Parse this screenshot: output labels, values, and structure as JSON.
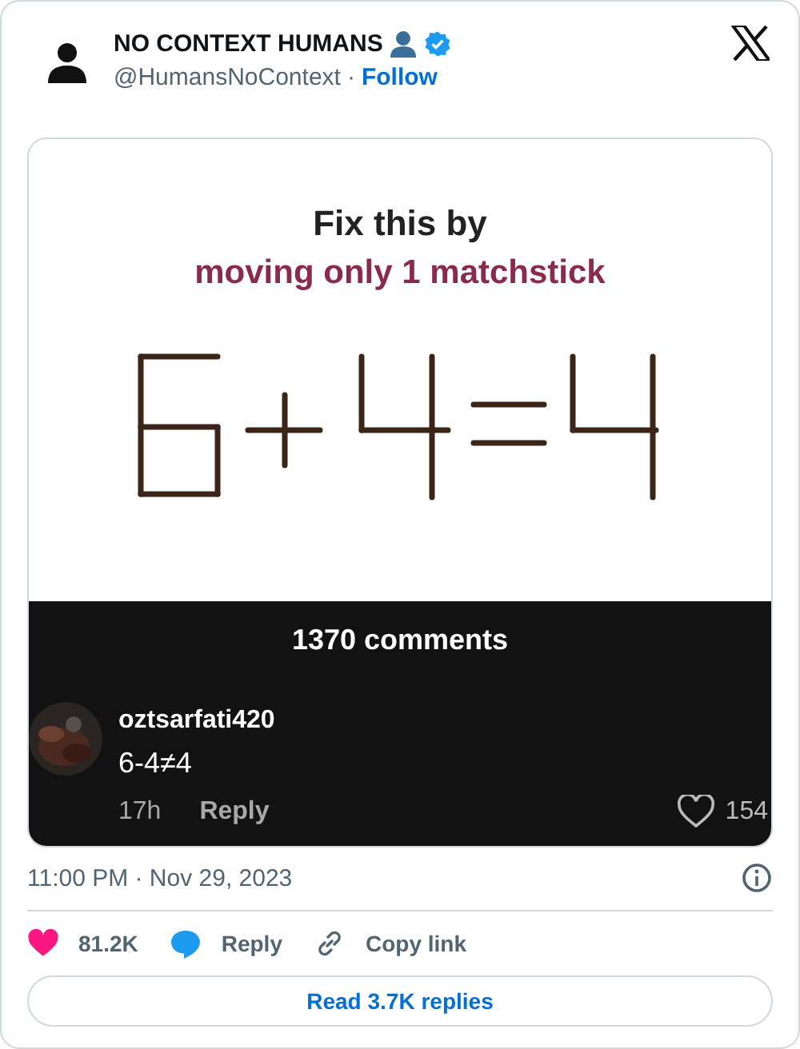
{
  "author": {
    "name": "NO CONTEXT HUMANS",
    "handle": "@HumansNoContext",
    "separator": "·",
    "follow": "Follow",
    "verified": true
  },
  "media": {
    "title": "Fix this by",
    "subtitle": "moving only 1 matchstick",
    "comments_header": "1370 comments",
    "comment": {
      "user": "oztsarfati420",
      "text": "6-4≠4",
      "time": "17h",
      "reply": "Reply",
      "likes": "154"
    }
  },
  "timestamp": "11:00 PM · Nov 29, 2023",
  "actions": [
    {
      "kind": "like",
      "label": "81.2K"
    },
    {
      "kind": "reply",
      "label": "Reply"
    },
    {
      "kind": "copy",
      "label": "Copy link"
    }
  ],
  "read_replies": "Read 3.7K replies"
}
